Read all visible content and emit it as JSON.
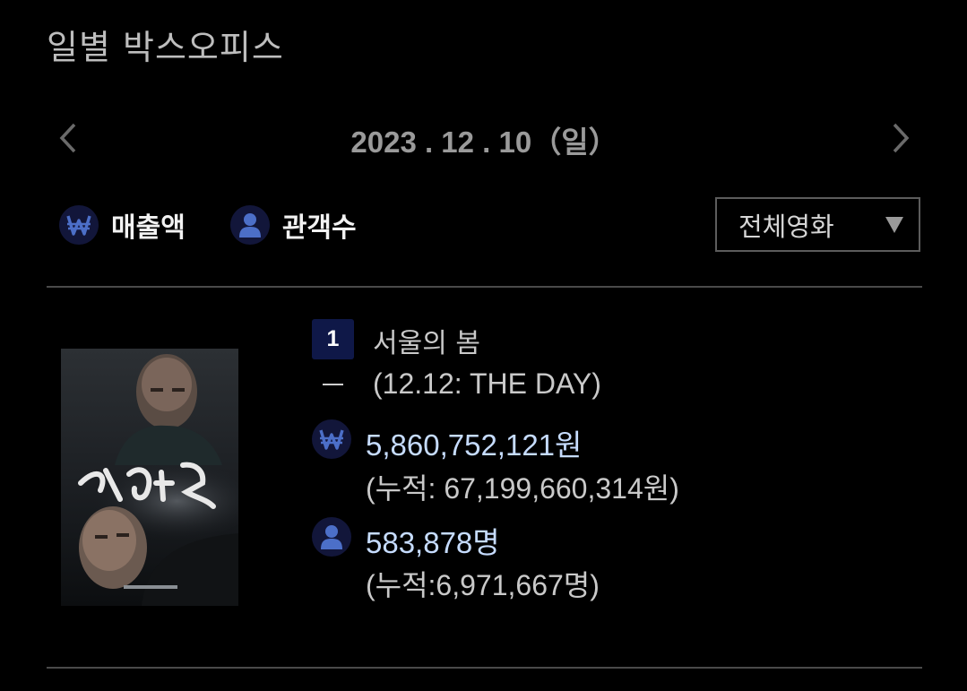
{
  "page": {
    "title": "일별 박스오피스"
  },
  "date_nav": {
    "date": "2023 . 12 . 10（일）"
  },
  "filters": {
    "sales_label": "매출액",
    "audience_label": "관객수"
  },
  "category_select": {
    "value": "전체영화"
  },
  "movies": [
    {
      "rank": "1",
      "rank_change": "—",
      "title": "서울의 봄",
      "english_title": "(12.12: THE DAY)",
      "sales": "5,860,752,121원",
      "sales_cumulative": "(누적: 67,199,660,314원)",
      "audience": "583,878명",
      "audience_cumulative": "(누적:6,971,667명)"
    }
  ],
  "colors": {
    "background": "#000000",
    "badge": "#0f1848",
    "icon_circle": "#12163a",
    "icon_glyph": "#4c6fc8",
    "value_text": "#c6dcff"
  },
  "icons": {
    "prev": "chevron-left-icon",
    "next": "chevron-right-icon",
    "sales": "won-icon",
    "audience": "person-icon",
    "select": "caret-down-icon"
  }
}
